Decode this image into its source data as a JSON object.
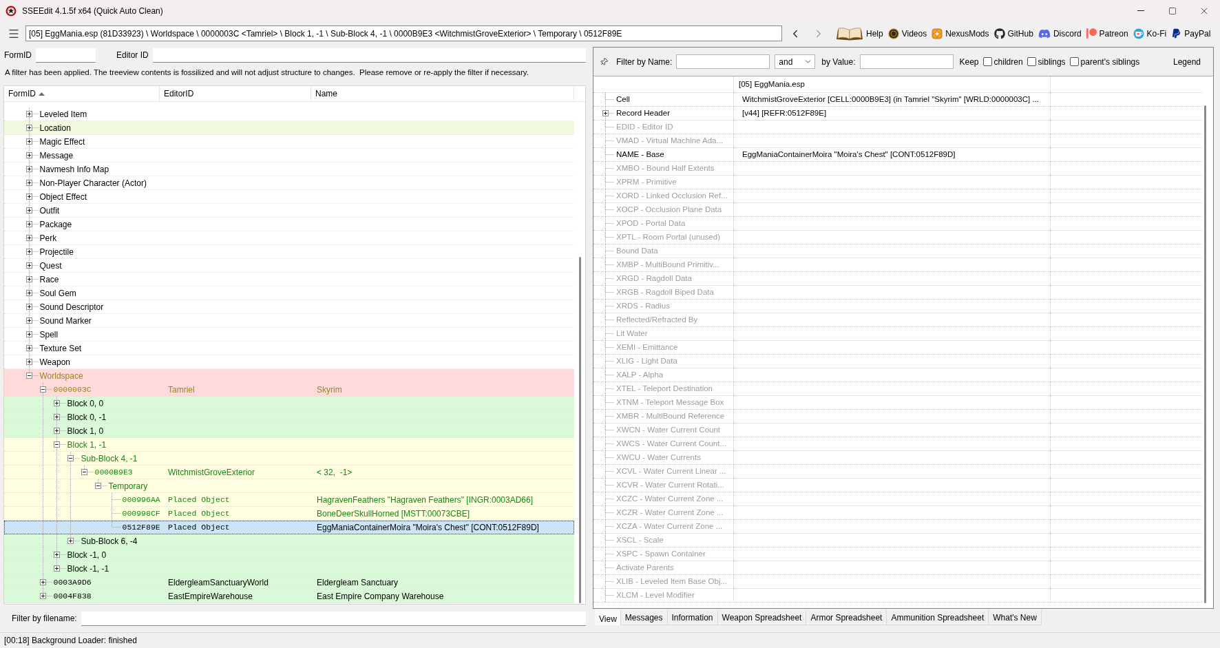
{
  "window": {
    "title": "SSEEdit 4.1.5f x64 (Quick Auto Clean)"
  },
  "toolbar": {
    "path": "[05] EggMania.esp (81D33923) \\ Worldspace \\ 0000003C <Tamriel> \\ Block 1, -1 \\ Sub-Block 4, -1 \\ 0000B9E3 <WitchmistGroveExterior> \\ Temporary \\ 0512F89E",
    "nav": [
      {
        "kind": "back",
        "disabled": false
      },
      {
        "kind": "forward",
        "disabled": true
      }
    ],
    "links": [
      {
        "kind": "book",
        "label": "Help"
      },
      {
        "kind": "coin",
        "label": "Videos"
      },
      {
        "kind": "nexus",
        "label": "NexusMods"
      },
      {
        "kind": "github",
        "label": "GitHub"
      },
      {
        "kind": "discord",
        "label": "Discord"
      },
      {
        "kind": "patreon",
        "label": "Patreon"
      },
      {
        "kind": "kofi",
        "label": "Ko-Fi"
      },
      {
        "kind": "paypal",
        "label": "PayPal"
      }
    ]
  },
  "search": {
    "form_id_label": "FormID",
    "editor_id_label": "Editor ID"
  },
  "filter_notice": "A filter has been applied. The treeview contents is fossilized and will not adjust structure to changes.  Please remove or re-apply the filter if necessary.",
  "tree": {
    "columns": [
      {
        "label": "FormID",
        "sorted": true
      },
      {
        "label": "EditorID"
      },
      {
        "label": "Name"
      }
    ],
    "items": [
      {
        "kind": "group",
        "label": "Leveled Item",
        "expanded": false,
        "selected": false
      },
      {
        "kind": "group",
        "label": "Location",
        "expanded": false,
        "selected": false,
        "fill": {
          "color": "#effadf"
        }
      },
      {
        "kind": "group",
        "label": "Magic Effect",
        "expanded": false,
        "selected": false
      },
      {
        "kind": "group",
        "label": "Message",
        "expanded": false,
        "selected": false
      },
      {
        "kind": "group",
        "label": "Navmesh Info Map",
        "expanded": false,
        "selected": false
      },
      {
        "kind": "group",
        "label": "Non-Player Character (Actor)",
        "expanded": false,
        "selected": false
      },
      {
        "kind": "group",
        "label": "Object Effect",
        "expanded": false,
        "selected": false
      },
      {
        "kind": "group",
        "label": "Outfit",
        "expanded": false,
        "selected": false
      },
      {
        "kind": "group",
        "label": "Package",
        "expanded": false,
        "selected": false
      },
      {
        "kind": "group",
        "label": "Perk",
        "expanded": false,
        "selected": false
      },
      {
        "kind": "group",
        "label": "Projectile",
        "expanded": false,
        "selected": false
      },
      {
        "kind": "group",
        "label": "Quest",
        "expanded": false,
        "selected": false
      },
      {
        "kind": "group",
        "label": "Race",
        "expanded": false,
        "selected": false
      },
      {
        "kind": "group",
        "label": "Soul Gem",
        "expanded": false,
        "selected": false
      },
      {
        "kind": "group",
        "label": "Sound Descriptor",
        "expanded": false,
        "selected": false
      },
      {
        "kind": "group",
        "label": "Sound Marker",
        "expanded": false,
        "selected": false
      },
      {
        "kind": "group",
        "label": "Spell",
        "expanded": false,
        "selected": false
      },
      {
        "kind": "group",
        "label": "Texture Set",
        "expanded": false,
        "selected": false
      },
      {
        "kind": "group",
        "label": "Weapon",
        "expanded": false,
        "selected": false
      },
      {
        "kind": "group",
        "label": "Worldspace",
        "expanded": true,
        "selected": false,
        "fill": {
          "color": "#ffdada"
        },
        "color": "#9a8418",
        "children": [
          {
            "kind": "record",
            "form_id": "0000003C",
            "editor_id": "Tamriel",
            "name": "Skyrim",
            "expanded": true,
            "selected": false,
            "fill": {
              "color": "#ffdada"
            },
            "color": "#9a8418",
            "children": [
              {
                "kind": "group",
                "label": "Block 0, 0",
                "expanded": false,
                "selected": false,
                "fill": {
                  "color": "#d9f9d9"
                }
              },
              {
                "kind": "group",
                "label": "Block 0, -1",
                "expanded": false,
                "selected": false,
                "fill": {
                  "color": "#d9f9d9"
                }
              },
              {
                "kind": "group",
                "label": "Block 1, 0",
                "expanded": false,
                "selected": false,
                "fill": {
                  "color": "#d9f9d9"
                }
              },
              {
                "kind": "group",
                "label": "Block 1, -1",
                "expanded": true,
                "selected": false,
                "fill": {
                  "color": "#fffee0"
                },
                "color": "#128a12",
                "children": [
                  {
                    "kind": "group",
                    "label": "Sub-Block 4, -1",
                    "expanded": true,
                    "selected": false,
                    "fill": {
                      "color": "#fffee0"
                    },
                    "color": "#128a12",
                    "children": [
                      {
                        "kind": "record",
                        "form_id": "0000B9E3",
                        "editor_id": "WitchmistGroveExterior",
                        "name": "< 32,  -1>",
                        "expanded": true,
                        "selected": false,
                        "fill": {
                          "color": "#fffee0"
                        },
                        "color": "#128a12",
                        "children": [
                          {
                            "kind": "group",
                            "label": "Temporary",
                            "expanded": true,
                            "selected": false,
                            "fill": {
                              "color": "#fffee0"
                            },
                            "color": "#128a12",
                            "children": [
                              {
                                "kind": "reference",
                                "form_id": "000996AA",
                                "editor_id": "Placed Object",
                                "name": "HagravenFeathers \"Hagraven Feathers\" [INGR:0003AD66]",
                                "selected": false,
                                "fill": {
                                  "color": "#fffee0"
                                },
                                "color": "#128a12"
                              },
                              {
                                "kind": "reference",
                                "form_id": "000998CF",
                                "editor_id": "Placed Object",
                                "name": "BoneDeerSkullHorned [MSTT:00073CBE]",
                                "selected": false,
                                "fill": {
                                  "color": "#fffee0"
                                },
                                "color": "#128a12"
                              },
                              {
                                "kind": "reference",
                                "form_id": "0512F89E",
                                "editor_id": "Placed Object",
                                "name": "EggManiaContainerMoira \"Moira's Chest\" [CONT:0512F89D]",
                                "selected": true
                              }
                            ]
                          }
                        ]
                      }
                    ]
                  },
                  {
                    "kind": "group",
                    "label": "Sub-Block 6, -4",
                    "expanded": false,
                    "selected": false,
                    "fill": {
                      "color": "#d9f9d9"
                    }
                  }
                ]
              },
              {
                "kind": "group",
                "label": "Block -1, 0",
                "expanded": false,
                "selected": false,
                "fill": {
                  "color": "#d9f9d9"
                }
              },
              {
                "kind": "group",
                "label": "Block -1, -1",
                "expanded": false,
                "selected": false,
                "fill": {
                  "color": "#d9f9d9"
                }
              }
            ]
          },
          {
            "kind": "record",
            "form_id": "0003A9D6",
            "editor_id": "EldergleamSanctuaryWorld",
            "name": "Eldergleam Sanctuary",
            "expanded": false,
            "selected": false,
            "fill": {
              "color": "#d9f9d9"
            }
          },
          {
            "kind": "record",
            "form_id": "0004F838",
            "editor_id": "EastEmpireWarehouse",
            "name": "East Empire Company Warehouse",
            "expanded": false,
            "selected": false,
            "fill": {
              "color": "#d9f9d9"
            }
          }
        ]
      }
    ]
  },
  "file_filter": {
    "label": "Filter by filename:"
  },
  "record_filter": {
    "name_label": "Filter by Name:",
    "operator": "and",
    "value_label": "by Value:",
    "keep_label": "Keep",
    "options": [
      {
        "label": "children",
        "checked": false
      },
      {
        "label": "siblings",
        "checked": false
      },
      {
        "label": "parent's siblings",
        "checked": false
      }
    ],
    "legend_button": "Legend"
  },
  "record_view": {
    "column_header": "[05] EggMania.esp",
    "rows": [
      {
        "label": "Cell",
        "value": "WitchmistGroveExterior [CELL:0000B9E3] (in Tamriel \"Skyrim\" [WRLD:0000003C] ...",
        "disabled": false
      },
      {
        "label": "Record Header",
        "value": "[v44] [REFR:0512F89E]",
        "expanded": false,
        "disabled": false
      },
      {
        "label": "EDID - Editor ID",
        "disabled": true
      },
      {
        "label": "VMAD - Virtual Machine Ada...",
        "disabled": true
      },
      {
        "label": "NAME - Base",
        "value": "EggManiaContainerMoira \"Moira's Chest\" [CONT:0512F89D]",
        "disabled": false
      },
      {
        "label": "XMBO - Bound Half Extents",
        "disabled": true
      },
      {
        "label": "XPRM - Primitive",
        "disabled": true
      },
      {
        "label": "XORD - Linked Occlusion Ref...",
        "disabled": true
      },
      {
        "label": "XOCP - Occlusion Plane Data",
        "disabled": true
      },
      {
        "label": "XPOD - Portal Data",
        "disabled": true
      },
      {
        "label": "XPTL - Room Portal (unused)",
        "disabled": true
      },
      {
        "label": "Bound Data",
        "disabled": true
      },
      {
        "label": "XMBP - MultiBound Primitiv...",
        "disabled": true
      },
      {
        "label": "XRGD - Ragdoll Data",
        "disabled": true
      },
      {
        "label": "XRGB - Ragdoll Biped Data",
        "disabled": true
      },
      {
        "label": "XRDS - Radius",
        "disabled": true
      },
      {
        "label": "Reflected/Refracted By",
        "disabled": true
      },
      {
        "label": "Lit Water",
        "disabled": true
      },
      {
        "label": "XEMI - Emittance",
        "disabled": true
      },
      {
        "label": "XLIG - Light Data",
        "disabled": true
      },
      {
        "label": "XALP - Alpha",
        "disabled": true
      },
      {
        "label": "XTEL - Teleport Destination",
        "disabled": true
      },
      {
        "label": "XTNM - Teleport Message Box",
        "disabled": true
      },
      {
        "label": "XMBR - MultiBound Reference",
        "disabled": true
      },
      {
        "label": "XWCN - Water Current Count",
        "disabled": true
      },
      {
        "label": "XWCS - Water Current Count...",
        "disabled": true
      },
      {
        "label": "XWCU - Water Currents",
        "disabled": true
      },
      {
        "label": "XCVL - Water Current Linear ...",
        "disabled": true
      },
      {
        "label": "XCVR - Water Current Rotati...",
        "disabled": true
      },
      {
        "label": "XCZC - Water Current Zone ...",
        "disabled": true
      },
      {
        "label": "XCZR - Water Current Zone ...",
        "disabled": true
      },
      {
        "label": "XCZA - Water Current Zone ...",
        "disabled": true
      },
      {
        "label": "XSCL - Scale",
        "disabled": true
      },
      {
        "label": "XSPC - Spawn Container",
        "disabled": true
      },
      {
        "label": "Activate Parents",
        "disabled": true
      },
      {
        "label": "XLIB - Leveled Item Base Obj...",
        "disabled": true
      },
      {
        "label": "XLCM - Level Modifier",
        "disabled": true
      }
    ]
  },
  "tabs": [
    {
      "label": "View",
      "selected": true
    },
    {
      "label": "Messages",
      "selected": false
    },
    {
      "label": "Information",
      "selected": false
    },
    {
      "label": "Weapon Spreadsheet",
      "selected": false
    },
    {
      "label": "Armor Spreadsheet",
      "selected": false
    },
    {
      "label": "Ammunition Spreadsheet",
      "selected": false
    },
    {
      "label": "What's New",
      "selected": false
    }
  ],
  "status_bar": "[00:18] Background Loader: finished"
}
